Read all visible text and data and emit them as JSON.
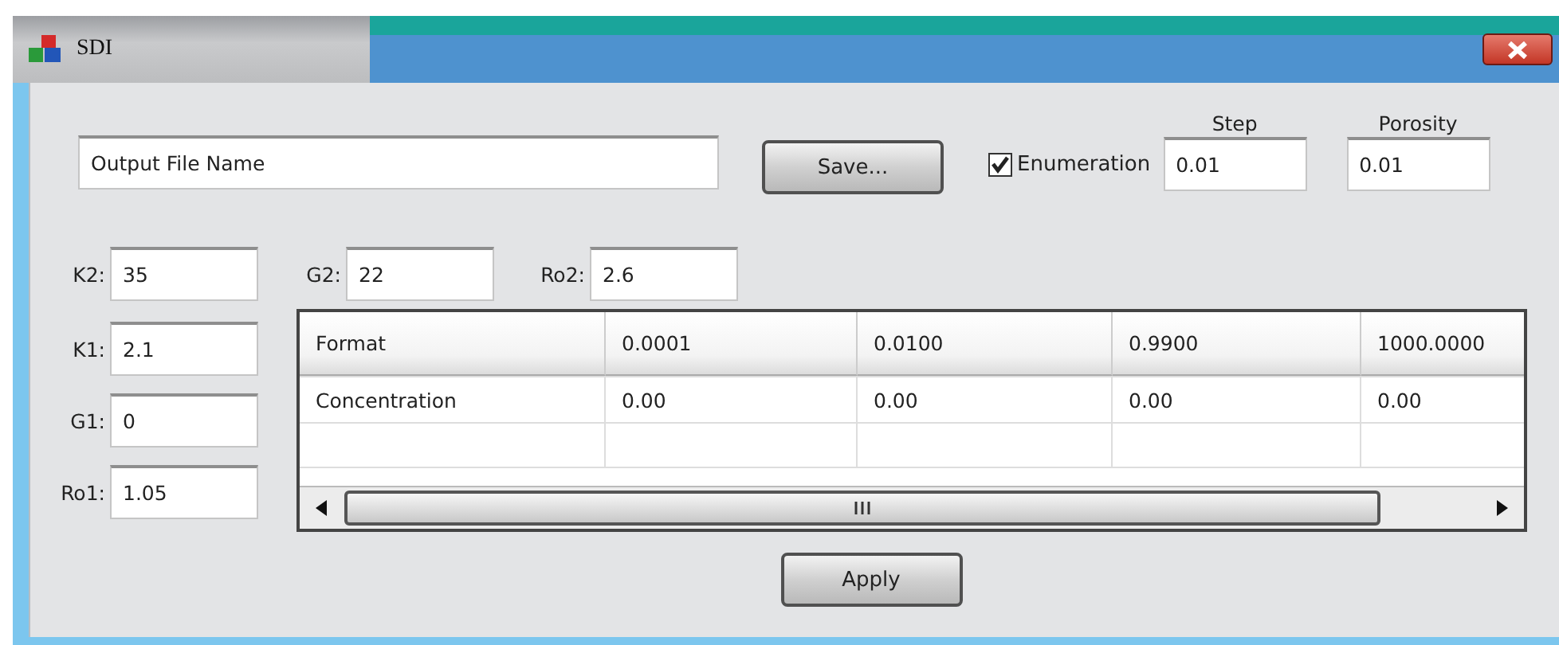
{
  "window": {
    "title": "SDI"
  },
  "output_file": {
    "value": "Output File Name"
  },
  "save_button": "Save...",
  "enumeration": {
    "label": "Enumeration",
    "checked": true
  },
  "step": {
    "label": "Step",
    "value": "0.01"
  },
  "porosity": {
    "label": "Porosity",
    "value": "0.01"
  },
  "top_params": [
    {
      "label": "K2:",
      "value": "35"
    },
    {
      "label": "G2:",
      "value": "22"
    },
    {
      "label": "Ro2:",
      "value": "2.6"
    }
  ],
  "left_params": [
    {
      "label": "K1:",
      "value": "2.1"
    },
    {
      "label": "G1:",
      "value": "0"
    },
    {
      "label": "Ro1:",
      "value": "1.05"
    }
  ],
  "table": {
    "header": [
      "Format",
      "0.0001",
      "0.0100",
      "0.9900",
      "1000.0000"
    ],
    "rows": [
      [
        "Concentration",
        "0.00",
        "0.00",
        "0.00",
        "0.00"
      ]
    ]
  },
  "apply_button": "Apply"
}
